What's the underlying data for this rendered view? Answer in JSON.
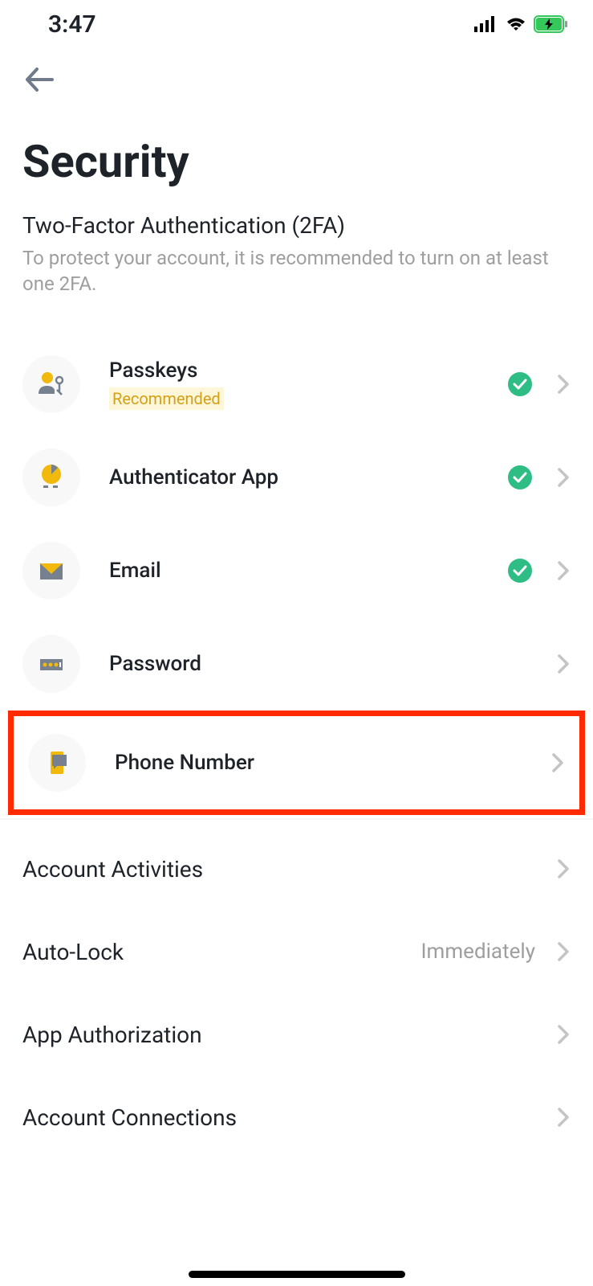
{
  "status_bar": {
    "time": "3:47"
  },
  "page": {
    "title": "Security"
  },
  "sections": {
    "tfa": {
      "title": "Two-Factor Authentication (2FA)",
      "description": "To protect your account, it is recommended to turn on at least one 2FA."
    }
  },
  "tfa_items": [
    {
      "label": "Passkeys",
      "badge": "Recommended",
      "checked": true
    },
    {
      "label": "Authenticator App",
      "checked": true
    },
    {
      "label": "Email",
      "checked": true
    },
    {
      "label": "Password",
      "checked": false
    },
    {
      "label": "Phone Number",
      "checked": false,
      "highlighted": true
    }
  ],
  "settings_items": [
    {
      "label": "Account Activities",
      "value": ""
    },
    {
      "label": "Auto-Lock",
      "value": "Immediately"
    },
    {
      "label": "App Authorization",
      "value": ""
    },
    {
      "label": "Account Connections",
      "value": ""
    }
  ]
}
